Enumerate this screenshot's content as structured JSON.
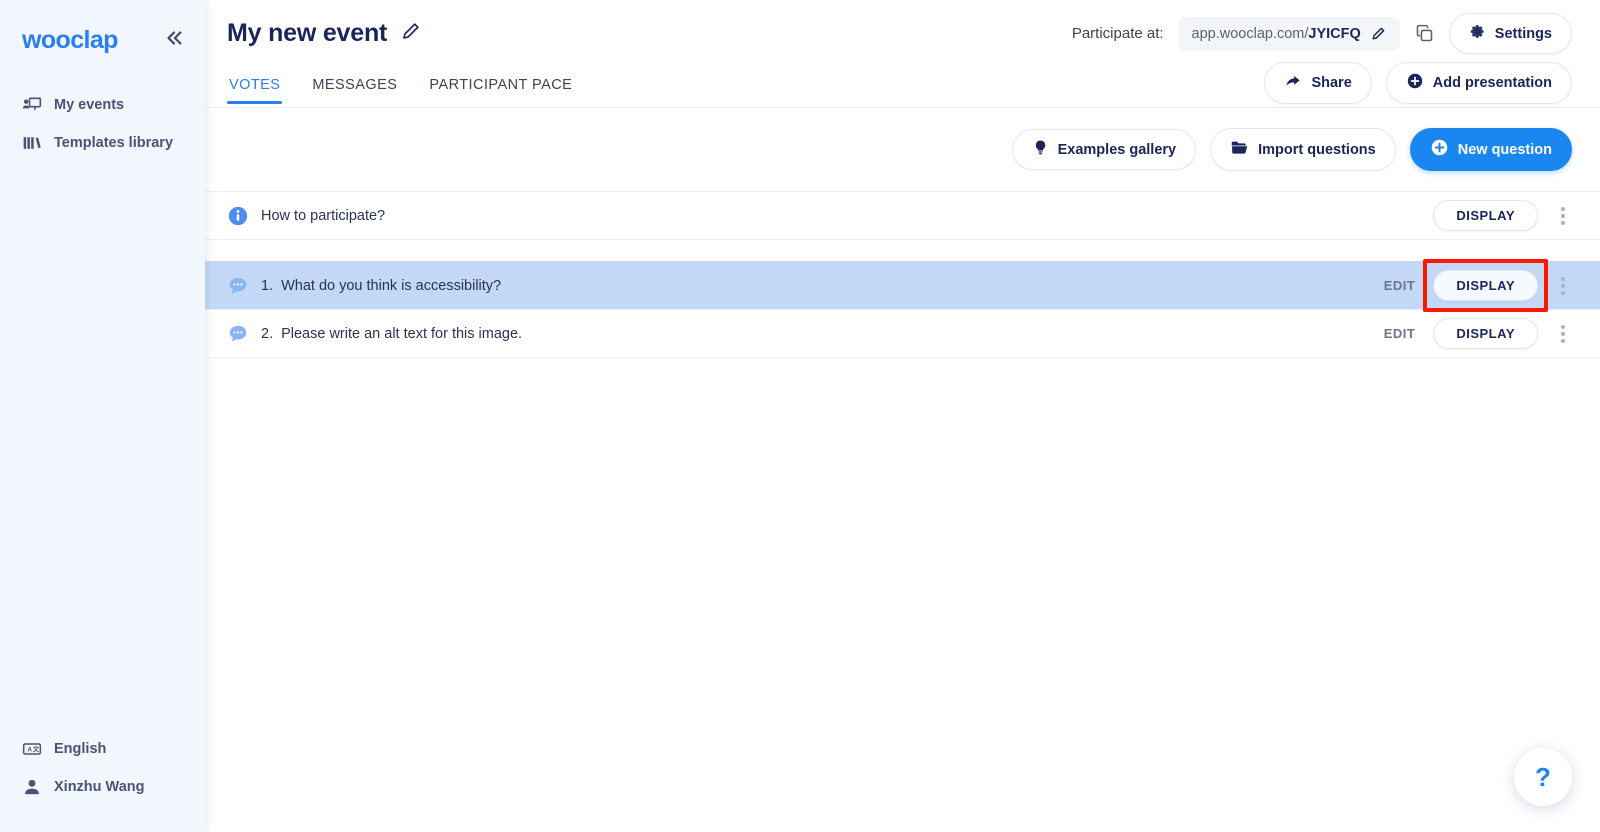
{
  "sidebar": {
    "brand": "wooclap",
    "collapse_icon": "chevron-double-left-icon",
    "items": [
      {
        "label": "My events",
        "icon": "presentation-user-icon"
      },
      {
        "label": "Templates library",
        "icon": "books-library-icon"
      }
    ],
    "bottom_items": [
      {
        "label": "English",
        "icon": "translate-icon"
      },
      {
        "label": "Xinzhu Wang",
        "icon": "user-icon"
      }
    ]
  },
  "header": {
    "title": "My new event",
    "edit_icon": "pencil-icon",
    "participate_label": "Participate at:",
    "url_prefix": "app.wooclap.com/",
    "url_code": "JYICFQ",
    "url_edit_icon": "pencil-icon",
    "copy_icon": "copy-icon",
    "settings_label": "Settings",
    "settings_icon": "gear-icon",
    "share_label": "Share",
    "share_icon": "share-arrow-icon",
    "add_presentation_label": "Add presentation",
    "add_presentation_icon": "plus-circle-icon"
  },
  "tabs": [
    {
      "label": "VOTES",
      "active": true
    },
    {
      "label": "MESSAGES",
      "active": false
    },
    {
      "label": "PARTICIPANT PACE",
      "active": false
    }
  ],
  "actionbar": {
    "examples_label": "Examples gallery",
    "examples_icon": "lightbulb-icon",
    "import_label": "Import questions",
    "import_icon": "folder-icon",
    "new_question_label": "New question",
    "new_question_icon": "plus-circle-icon"
  },
  "questions": {
    "info_row": {
      "label": "How to participate?",
      "icon": "info-circle-icon",
      "display_label": "DISPLAY",
      "menu_icon": "kebab-menu-icon"
    },
    "edit_label": "EDIT",
    "display_label": "DISPLAY",
    "items": [
      {
        "number": "1.",
        "text": "What do you think is accessibility?",
        "icon": "message-bubble-icon",
        "selected": true
      },
      {
        "number": "2.",
        "text": "Please write an alt text for this image.",
        "icon": "message-bubble-icon",
        "selected": false
      }
    ]
  },
  "help": {
    "label": "?",
    "icon": "question-mark-icon"
  },
  "colors": {
    "brand_blue": "#2a7df4",
    "primary_button": "#1a86f0",
    "sidebar_bg": "#f2f6fd",
    "selected_row": "#c3d8f7",
    "highlight_box": "#fb1a00",
    "text_dark": "#1b2559"
  }
}
